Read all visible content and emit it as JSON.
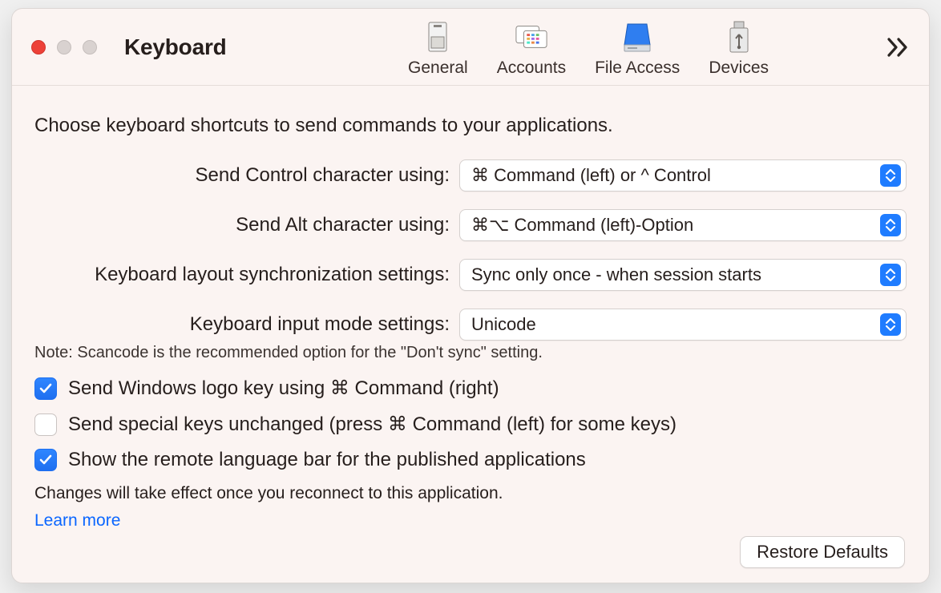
{
  "window": {
    "title": "Keyboard"
  },
  "toolbar": {
    "tabs": [
      {
        "id": "general",
        "label": "General"
      },
      {
        "id": "accounts",
        "label": "Accounts"
      },
      {
        "id": "file-access",
        "label": "File Access"
      },
      {
        "id": "devices",
        "label": "Devices"
      }
    ],
    "overflow_icon": "chevrons-right"
  },
  "body": {
    "intro": "Choose keyboard shortcuts to send commands to your applications.",
    "rows": {
      "control": {
        "label": "Send Control character using:",
        "value": "⌘ Command (left) or ^ Control"
      },
      "alt": {
        "label": "Send Alt character using:",
        "value": "⌘⌥ Command (left)-Option"
      },
      "layout_sync": {
        "label": "Keyboard layout synchronization settings:",
        "value": "Sync only once - when session starts"
      },
      "input_mode": {
        "label": "Keyboard input mode settings:",
        "value": "Unicode"
      }
    },
    "note": "Note: Scancode is the recommended option for the \"Don't sync\" setting.",
    "checks": {
      "winlogo": {
        "checked": true,
        "label": "Send Windows logo key using ⌘  Command (right)"
      },
      "special": {
        "checked": false,
        "label": "Send special keys unchanged (press ⌘ Command (left) for some keys)"
      },
      "langbar": {
        "checked": true,
        "label": "Show the remote language bar for the published applications"
      }
    },
    "effect_note": "Changes will take effect once you reconnect to this application.",
    "learn_more": "Learn more",
    "restore_defaults": "Restore Defaults"
  }
}
